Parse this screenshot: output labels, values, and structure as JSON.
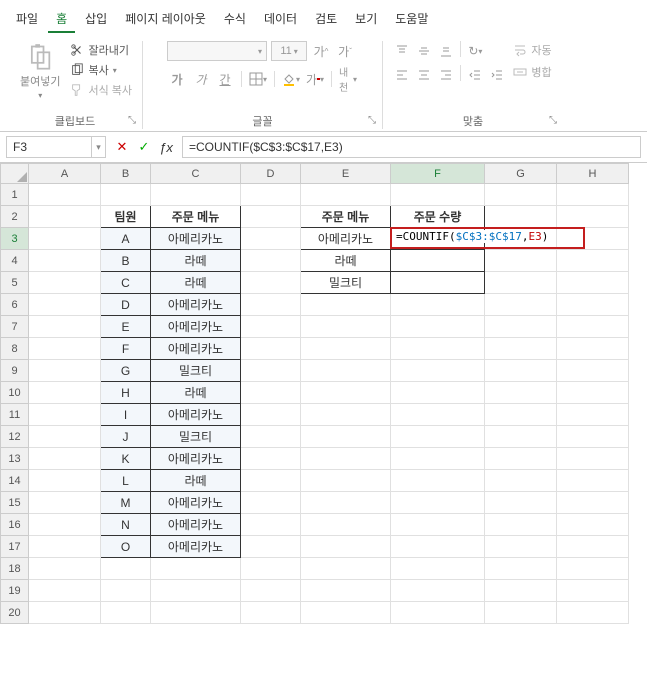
{
  "menubar": {
    "items": [
      "파일",
      "홈",
      "삽입",
      "페이지 레이아웃",
      "수식",
      "데이터",
      "검토",
      "보기",
      "도움말"
    ],
    "active_index": 1
  },
  "ribbon": {
    "clipboard": {
      "label": "클립보드",
      "paste": "붙여넣기",
      "cut": "잘라내기",
      "copy": "복사",
      "format_painter": "서식 복사"
    },
    "font": {
      "label": "글꼴",
      "name_placeholder": "",
      "size_placeholder": "11",
      "inc": "가",
      "dec": "가",
      "bold": "가",
      "italic": "가",
      "underline": "간",
      "mid": "내천"
    },
    "align": {
      "label": "맞춤",
      "wrap": "자동",
      "merge": "병합"
    }
  },
  "namebox": {
    "value": "F3"
  },
  "formula_bar": {
    "value": "=COUNTIF($C$3:$C$17,E3)"
  },
  "columns": [
    "A",
    "B",
    "C",
    "D",
    "E",
    "F",
    "G",
    "H"
  ],
  "rows": [
    1,
    2,
    3,
    4,
    5,
    6,
    7,
    8,
    9,
    10,
    11,
    12,
    13,
    14,
    15,
    16,
    17,
    18,
    19,
    20
  ],
  "table_left": {
    "hdr_team": "팀원",
    "hdr_menu": "주문 메뉴",
    "rows": [
      {
        "team": "A",
        "menu": "아메리카노"
      },
      {
        "team": "B",
        "menu": "라떼"
      },
      {
        "team": "C",
        "menu": "라떼"
      },
      {
        "team": "D",
        "menu": "아메리카노"
      },
      {
        "team": "E",
        "menu": "아메리카노"
      },
      {
        "team": "F",
        "menu": "아메리카노"
      },
      {
        "team": "G",
        "menu": "밀크티"
      },
      {
        "team": "H",
        "menu": "라떼"
      },
      {
        "team": "I",
        "menu": "아메리카노"
      },
      {
        "team": "J",
        "menu": "밀크티"
      },
      {
        "team": "K",
        "menu": "아메리카노"
      },
      {
        "team": "L",
        "menu": "라떼"
      },
      {
        "team": "M",
        "menu": "아메리카노"
      },
      {
        "team": "N",
        "menu": "아메리카노"
      },
      {
        "team": "O",
        "menu": "아메리카노"
      }
    ]
  },
  "table_right": {
    "hdr_menu": "주문 메뉴",
    "hdr_qty": "주문 수량",
    "rows": [
      {
        "menu": "아메리카노"
      },
      {
        "menu": "라떼"
      },
      {
        "menu": "밀크티"
      }
    ]
  },
  "f3_formula": {
    "prefix": "=COUNTIF(",
    "ref1": "$C$3:$C$17",
    "comma": ",",
    "ref2": "E3",
    "suffix": ")"
  },
  "active_cell": {
    "col": "F",
    "row": 3
  }
}
